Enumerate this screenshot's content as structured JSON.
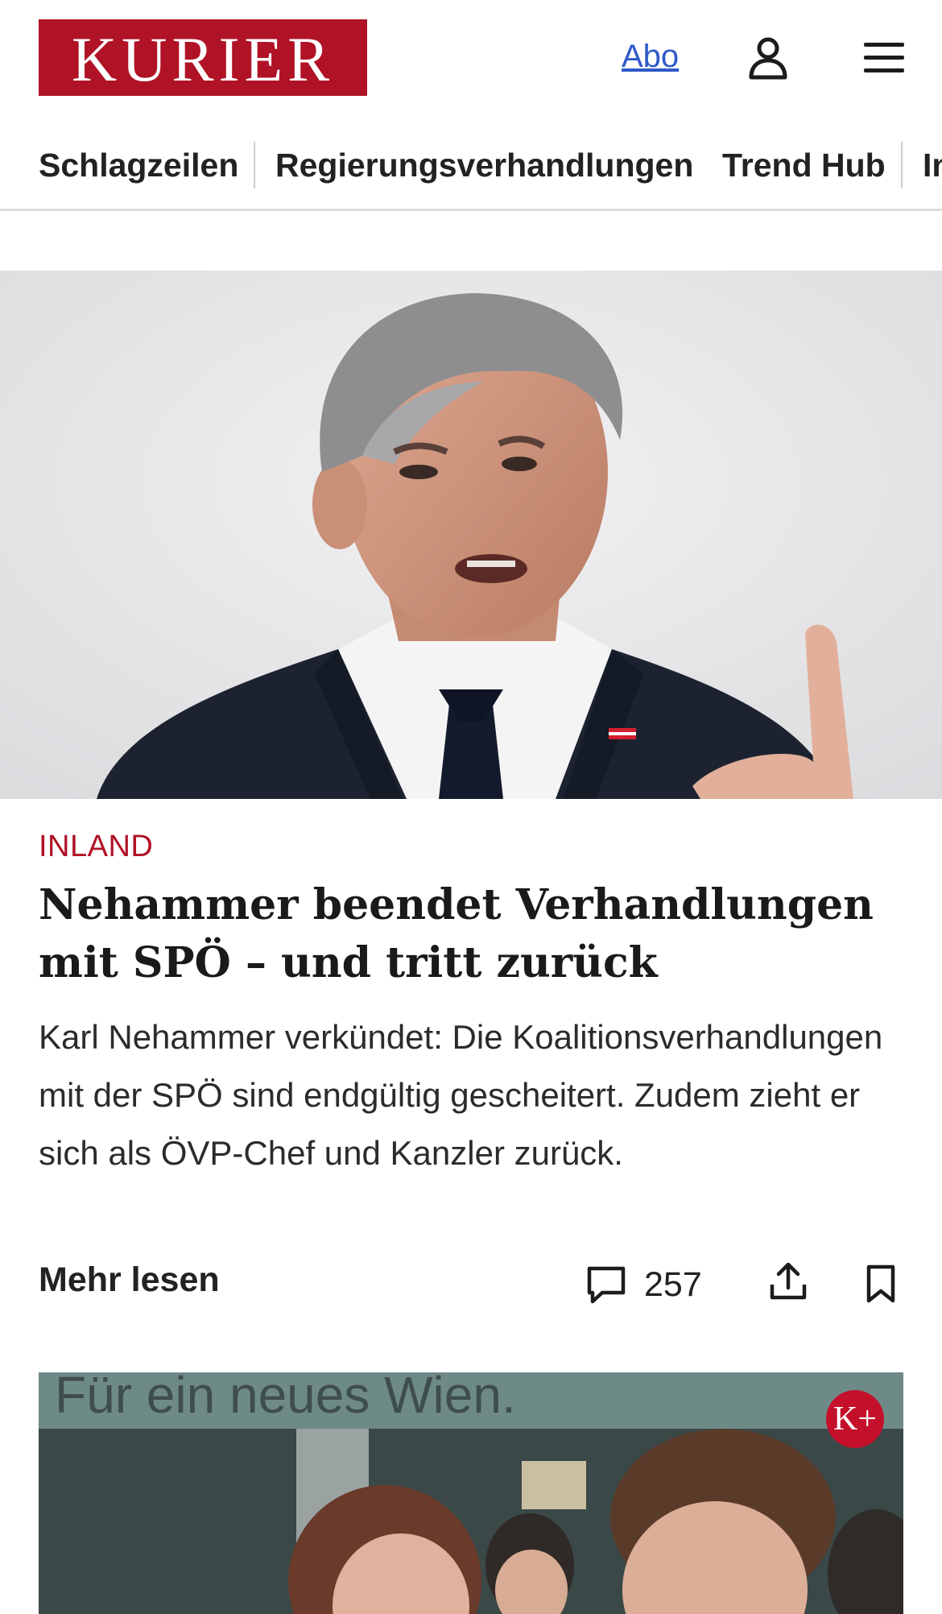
{
  "header": {
    "logo_text": "KURIER",
    "abo_label": "Abo",
    "brand_color": "#b01226",
    "link_color": "#2f59c9"
  },
  "nav": {
    "items": [
      {
        "label": "Schlagzeilen"
      },
      {
        "label": "Regierungsverhandlungen"
      },
      {
        "label": "Trend Hub"
      },
      {
        "label": "In"
      }
    ]
  },
  "article": {
    "kicker": "INLAND",
    "headline": "Nehammer beendet Verhandlungen mit SPÖ – und tritt zurück",
    "teaser": "Karl Nehammer verkündet: Die Koalitionsverhandlungen mit der SPÖ sind endgültig gescheitert. Zudem zieht er sich als ÖVP-Chef und Kanzler zurück.",
    "more_label": "Mehr lesen",
    "comment_count": "257"
  },
  "second_article": {
    "image_text": "Für ein neues Wien.",
    "badge": "K+"
  },
  "icons": {
    "user": "user-icon",
    "menu": "menu-icon",
    "comment": "comment-icon",
    "share": "share-icon",
    "bookmark": "bookmark-icon"
  }
}
